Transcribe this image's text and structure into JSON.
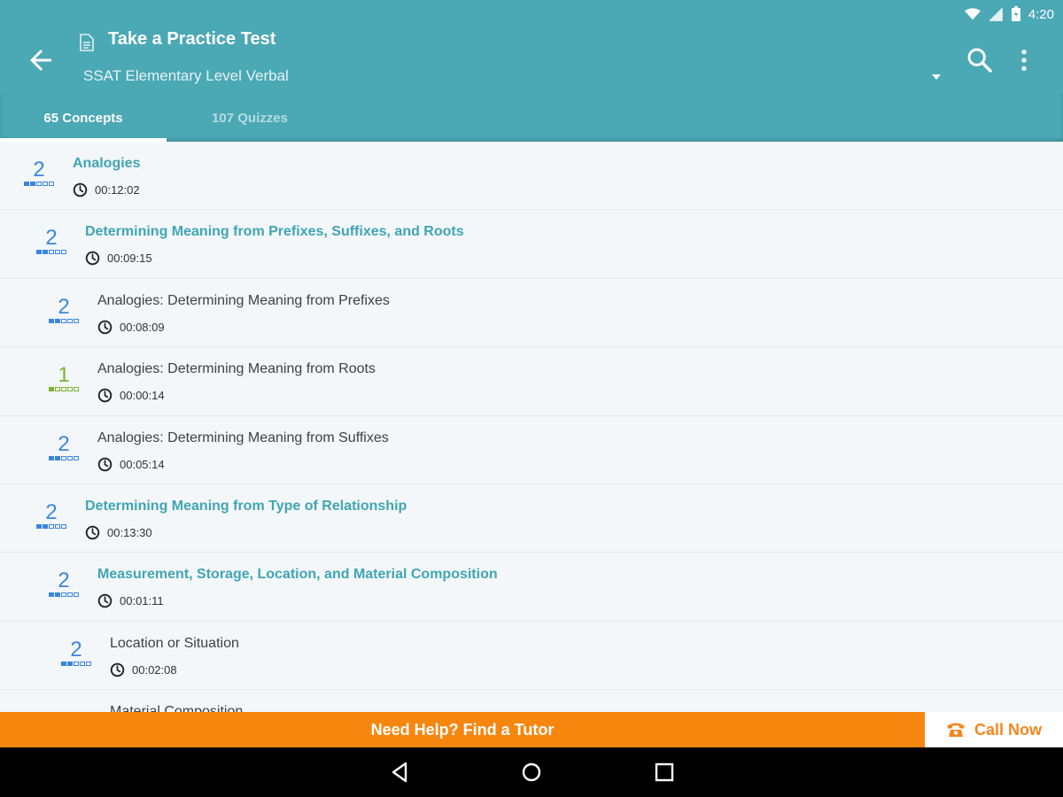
{
  "status_bar": {
    "time": "4:20"
  },
  "header": {
    "title": "Take a Practice Test",
    "subtitle": "SSAT Elementary Level Verbal"
  },
  "tabs": [
    {
      "label": "65 Concepts",
      "active": true
    },
    {
      "label": "107 Quizzes",
      "active": false
    }
  ],
  "items": [
    {
      "title": "Analogies",
      "time": "00:12:02",
      "level": "2",
      "type": "topic",
      "indent": 0
    },
    {
      "title": "Determining Meaning from Prefixes, Suffixes, and Roots",
      "time": "00:09:15",
      "level": "2",
      "type": "topic",
      "indent": 1
    },
    {
      "title": "Analogies: Determining Meaning from Prefixes",
      "time": "00:08:09",
      "level": "2",
      "type": "leaf",
      "indent": 2
    },
    {
      "title": "Analogies: Determining Meaning from Roots",
      "time": "00:00:14",
      "level": "1",
      "type": "leaf",
      "indent": 2
    },
    {
      "title": "Analogies: Determining Meaning from Suffixes",
      "time": "00:05:14",
      "level": "2",
      "type": "leaf",
      "indent": 2
    },
    {
      "title": "Determining Meaning from Type of Relationship",
      "time": "00:13:30",
      "level": "2",
      "type": "topic",
      "indent": 1
    },
    {
      "title": "Measurement, Storage, Location, and Material Composition",
      "time": "00:01:11",
      "level": "2",
      "type": "topic",
      "indent": 2
    },
    {
      "title": "Location or Situation",
      "time": "00:02:08",
      "level": "2",
      "type": "leaf",
      "indent": 3
    },
    {
      "title": "Material Composition",
      "time": "",
      "level": "",
      "type": "leaf",
      "indent": 3
    }
  ],
  "help_bar": {
    "label": "Need Help? Find a Tutor"
  },
  "call_button": {
    "label": "Call Now"
  },
  "colors": {
    "primary": "#4ba8b5",
    "topic_text": "#3fa5b4",
    "level2": "#3a86e0",
    "level1": "#7bb330",
    "accent_orange": "#f7860f"
  },
  "icons": {
    "back": "arrow-left",
    "doc": "document",
    "search": "magnifier",
    "more": "vertical-dots",
    "clock": "clock",
    "phone": "phone",
    "nav_back": "triangle-left",
    "nav_home": "circle",
    "nav_recents": "square"
  }
}
